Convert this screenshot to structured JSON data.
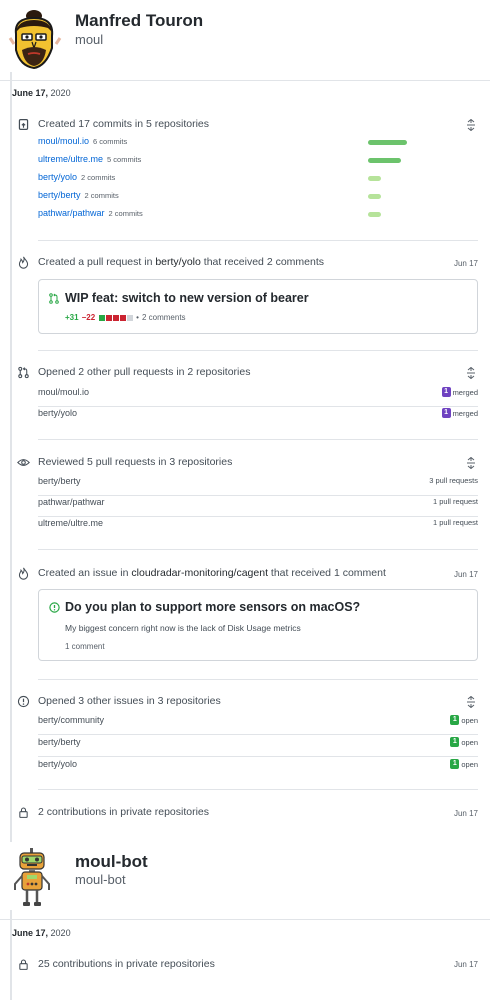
{
  "users": [
    {
      "name": "Manfred Touron",
      "login": "moul",
      "date": {
        "month_day": "June 17,",
        "year": "2020"
      }
    },
    {
      "name": "moul-bot",
      "login": "moul-bot",
      "date": {
        "month_day": "June 17,",
        "year": "2020"
      }
    }
  ],
  "commits": {
    "title": "Created 17 commits in 5 repositories",
    "rows": [
      {
        "repo": "moul/moul.io",
        "count": "6 commits",
        "ratio": 0.35
      },
      {
        "repo": "ultreme/ultre.me",
        "count": "5 commits",
        "ratio": 0.29
      },
      {
        "repo": "berty/yolo",
        "count": "2 commits",
        "ratio": 0.12
      },
      {
        "repo": "berty/berty",
        "count": "2 commits",
        "ratio": 0.12
      },
      {
        "repo": "pathwar/pathwar",
        "count": "2 commits",
        "ratio": 0.12
      }
    ]
  },
  "pr_created": {
    "prefix": "Created a pull request in",
    "repo": "berty/yolo",
    "suffix": "that received 2 comments",
    "date": "Jun 17",
    "card": {
      "title": "WIP feat: switch to new version of bearer",
      "additions": "+31",
      "deletions": "−22",
      "separator": "•",
      "comments": "2 comments"
    }
  },
  "pr_opened": {
    "title": "Opened 2 other pull requests in 2 repositories",
    "rows": [
      {
        "repo": "moul/moul.io",
        "count": "1",
        "status": "merged"
      },
      {
        "repo": "berty/yolo",
        "count": "1",
        "status": "merged"
      }
    ]
  },
  "reviewed": {
    "title": "Reviewed 5 pull requests in 3 repositories",
    "rows": [
      {
        "repo": "berty/berty",
        "count": "3 pull requests"
      },
      {
        "repo": "pathwar/pathwar",
        "count": "1 pull request"
      },
      {
        "repo": "ultreme/ultre.me",
        "count": "1 pull request"
      }
    ]
  },
  "issue_created": {
    "prefix": "Created an issue in",
    "repo": "cloudradar-monitoring/cagent",
    "suffix": "that received 1 comment",
    "date": "Jun 17",
    "card": {
      "title": "Do you plan to support more sensors on macOS?",
      "body": "My biggest concern right now is the lack of Disk Usage metrics",
      "comments": "1 comment"
    }
  },
  "issues_opened": {
    "title": "Opened 3 other issues in 3 repositories",
    "rows": [
      {
        "repo": "berty/community",
        "count": "1",
        "status": "open"
      },
      {
        "repo": "berty/berty",
        "count": "1",
        "status": "open"
      },
      {
        "repo": "berty/yolo",
        "count": "1",
        "status": "open"
      }
    ]
  },
  "private1": {
    "title": "2 contributions in private repositories",
    "date": "Jun 17"
  },
  "private2": {
    "title": "25 contributions in private repositories",
    "date": "Jun 17"
  },
  "colors": {
    "link": "#0366d6",
    "merged": "#6f42c1",
    "open": "#28a745",
    "bar_dark": "#6cc36c",
    "bar_light": "#b6e39a",
    "add": "#28a745",
    "del": "#cb2431"
  },
  "icons": [
    "repo-push-icon",
    "flame-icon",
    "git-pull-request-icon",
    "eye-icon",
    "issue-opened-icon",
    "lock-icon",
    "unfold-icon",
    "avatar-moul",
    "avatar-moul-bot"
  ]
}
